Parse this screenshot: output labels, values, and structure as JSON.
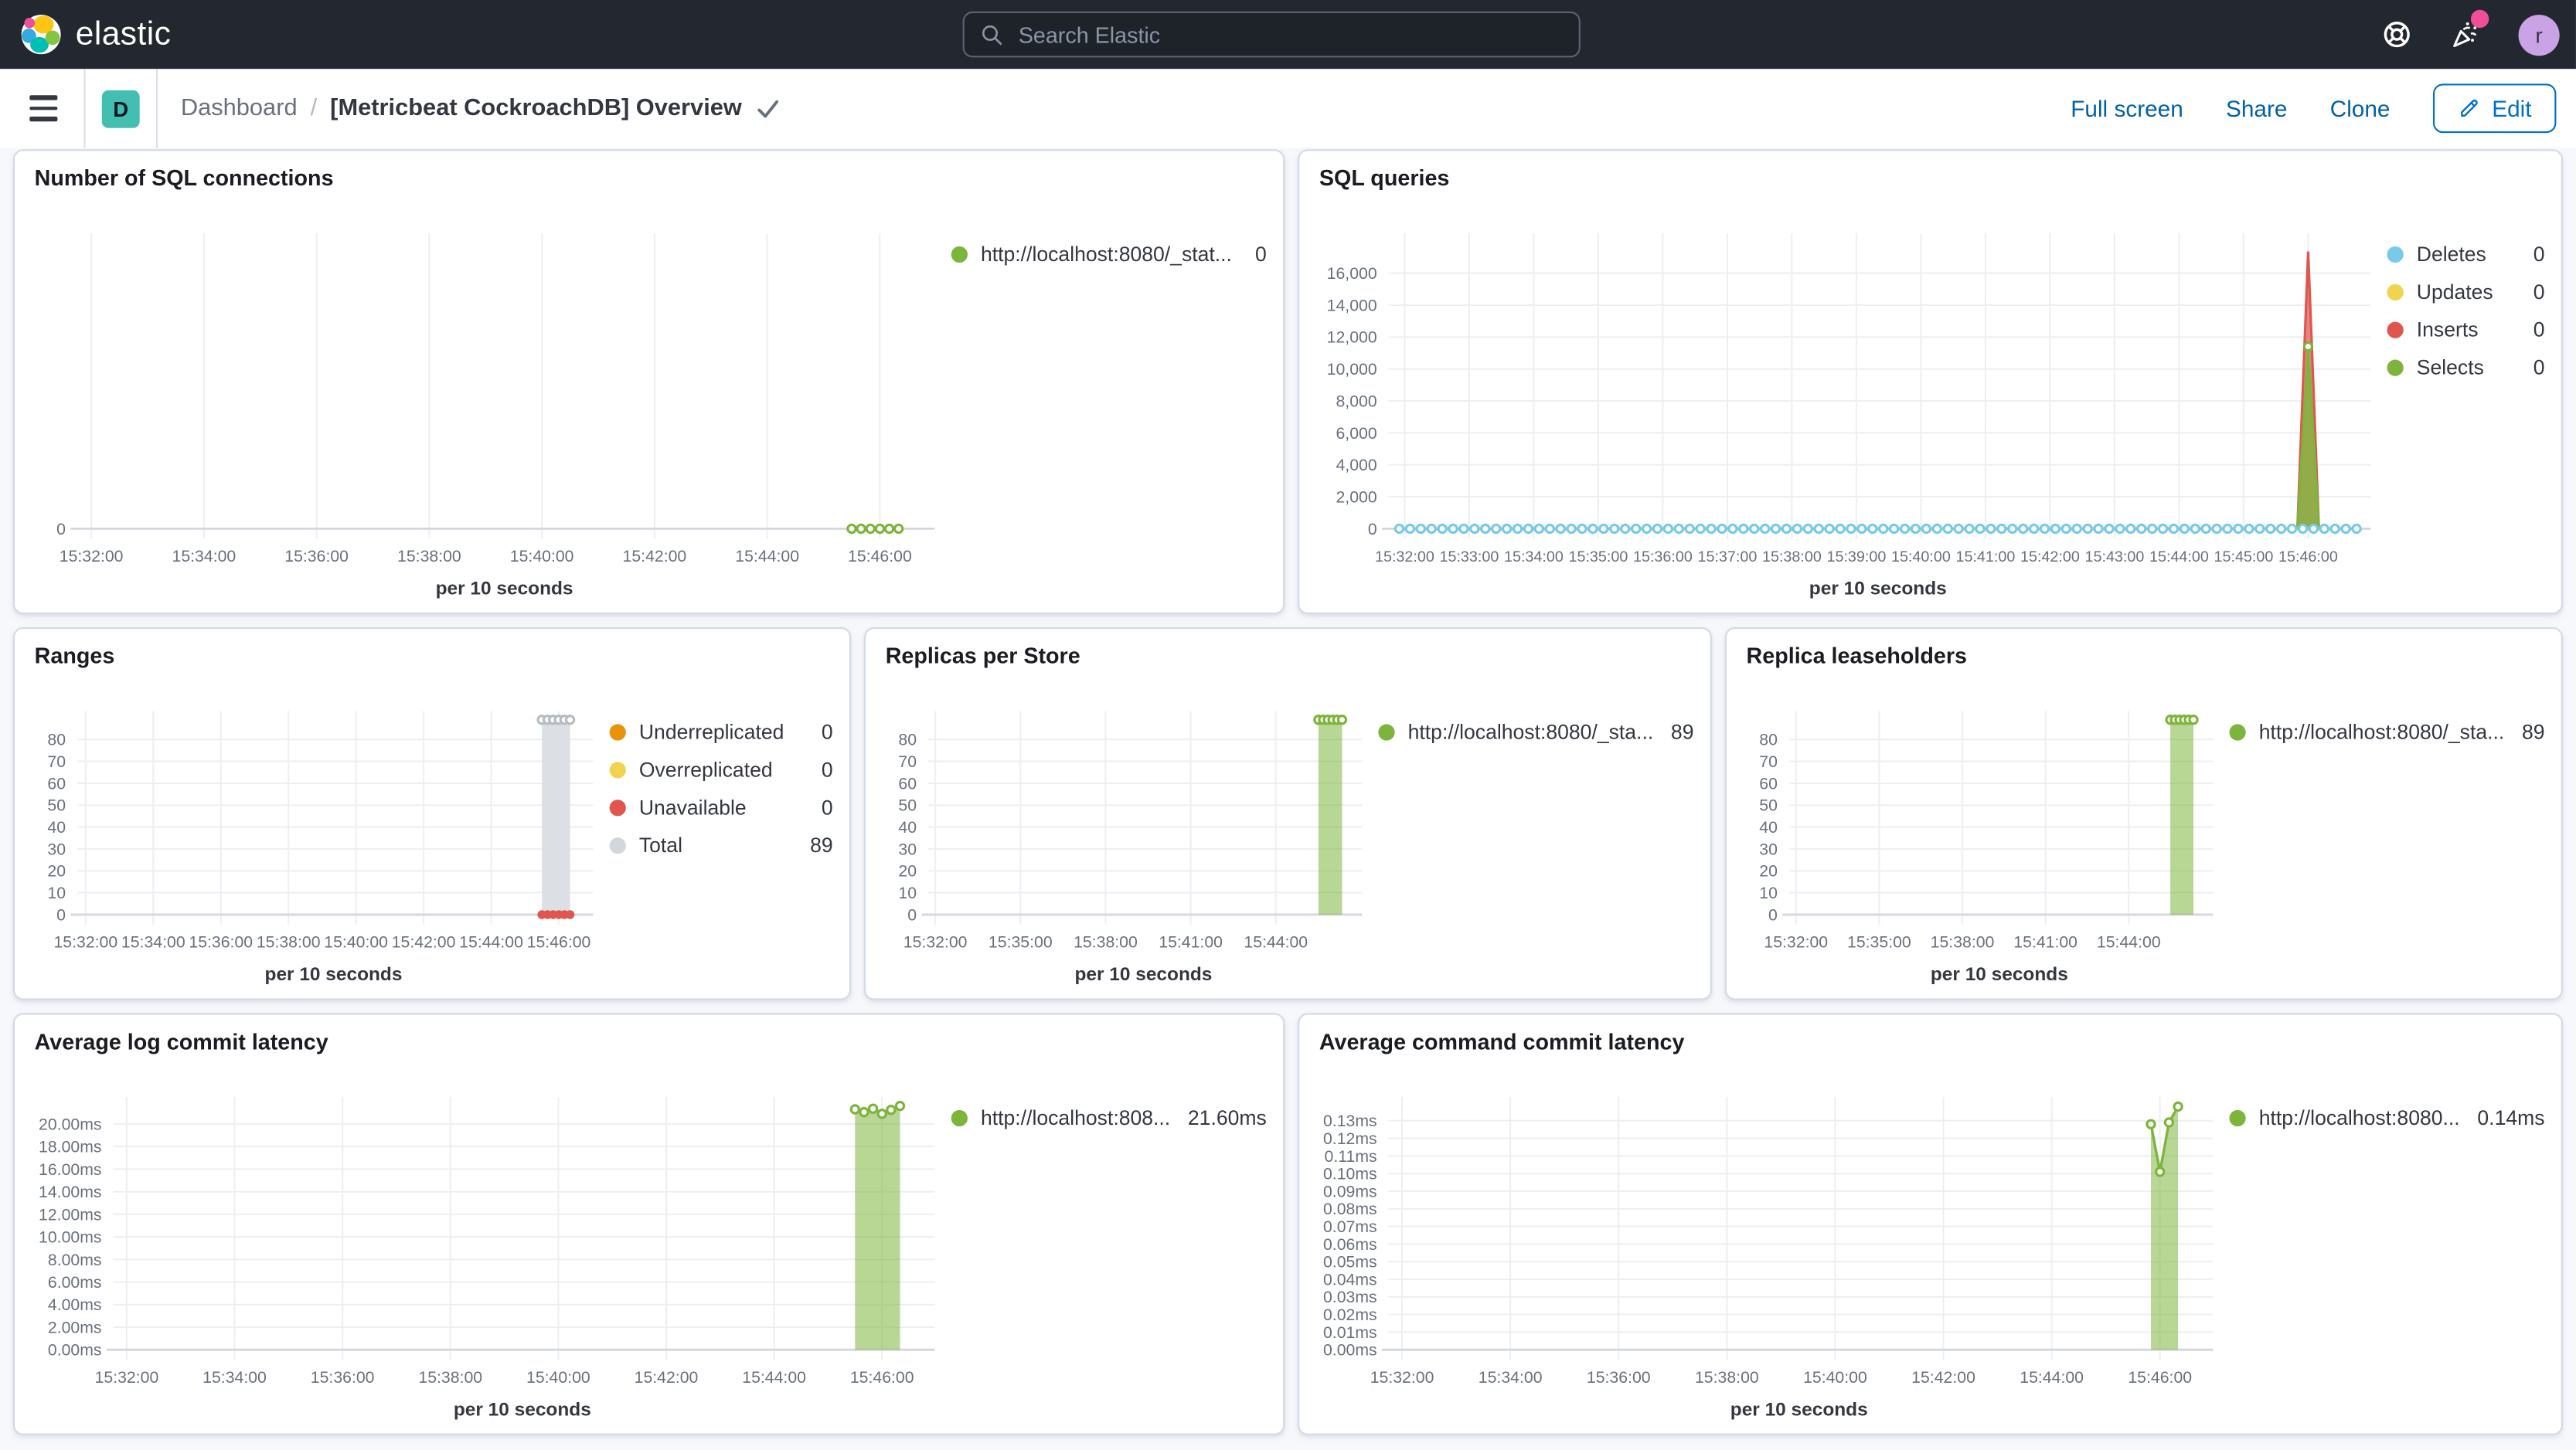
{
  "header": {
    "brand": "elastic",
    "search": {
      "placeholder": "Search Elastic"
    },
    "help_icon": "life-ring",
    "news_icon": "party-popper",
    "news_badge_color": "#f04e98",
    "avatar_initial": "r"
  },
  "toolbar": {
    "space_badge": "D",
    "breadcrumbs": [
      {
        "label": "Dashboard"
      }
    ],
    "separator": "/",
    "title": "[Metricbeat CockroachDB] Overview",
    "actions": [
      {
        "label": "Full screen"
      },
      {
        "label": "Share"
      },
      {
        "label": "Clone"
      }
    ],
    "edit_button": {
      "label": "Edit",
      "icon": "pencil"
    }
  },
  "colors": {
    "green": "#7db53c",
    "blue": "#79c9e8",
    "yellow": "#f0d44f",
    "red": "#e0564e",
    "orange": "#e8930c",
    "gray": "#d3d6db",
    "link_blue": "#0061a6",
    "header_bg": "#232830"
  },
  "panels": [
    {
      "title": "Number of SQL connections",
      "legend": [
        {
          "label": "http://localhost:8080/_stat...",
          "value": "0",
          "color": "#7db53c"
        }
      ],
      "chart_data": {
        "type": "line",
        "x_axis_title": "per 10 seconds",
        "x_domain": [
          0,
          910
        ],
        "y_max": 1,
        "x_ticks": [
          {
            "label": "15:32:00",
            "s": 15
          },
          {
            "label": "15:34:00",
            "s": 135
          },
          {
            "label": "15:36:00",
            "s": 255
          },
          {
            "label": "15:38:00",
            "s": 375
          },
          {
            "label": "15:40:00",
            "s": 495
          },
          {
            "label": "15:42:00",
            "s": 615
          },
          {
            "label": "15:44:00",
            "s": 735
          },
          {
            "label": "15:46:00",
            "s": 855
          }
        ],
        "y_ticks": [
          {
            "label": "0",
            "v": 0
          }
        ],
        "series": [
          {
            "name": "http://localhost:8080/_stat...",
            "color": "#7db53c",
            "width": 1.8,
            "expand": {
              "from": 825,
              "to": 875,
              "step": 10,
              "value": 0
            },
            "markers": {
              "shape": "hollow"
            }
          }
        ]
      }
    },
    {
      "title": "SQL queries",
      "legend": [
        {
          "label": "Deletes",
          "value": "0",
          "color": "#79c9e8"
        },
        {
          "label": "Updates",
          "value": "0",
          "color": "#f0d44f"
        },
        {
          "label": "Inserts",
          "value": "0",
          "color": "#e0564e"
        },
        {
          "label": "Selects",
          "value": "0",
          "color": "#7db53c"
        }
      ],
      "chart_data": {
        "type": "area",
        "x_axis_title": "per 10 seconds",
        "x_domain": [
          0,
          910
        ],
        "y_max": 18500,
        "x_ticks": [
          {
            "label": "15:32:00",
            "s": 15
          },
          {
            "label": "15:33:00",
            "s": 75
          },
          {
            "label": "15:34:00",
            "s": 135
          },
          {
            "label": "15:35:00",
            "s": 195
          },
          {
            "label": "15:36:00",
            "s": 255
          },
          {
            "label": "15:37:00",
            "s": 315
          },
          {
            "label": "15:38:00",
            "s": 375
          },
          {
            "label": "15:39:00",
            "s": 435
          },
          {
            "label": "15:40:00",
            "s": 495
          },
          {
            "label": "15:41:00",
            "s": 555
          },
          {
            "label": "15:42:00",
            "s": 615
          },
          {
            "label": "15:43:00",
            "s": 675
          },
          {
            "label": "15:44:00",
            "s": 735
          },
          {
            "label": "15:45:00",
            "s": 795
          },
          {
            "label": "15:46:00",
            "s": 855
          }
        ],
        "y_ticks": [
          {
            "label": "0",
            "v": 0
          },
          {
            "label": "2,000",
            "v": 2000
          },
          {
            "label": "4,000",
            "v": 4000
          },
          {
            "label": "6,000",
            "v": 6000
          },
          {
            "label": "8,000",
            "v": 8000
          },
          {
            "label": "10,000",
            "v": 10000
          },
          {
            "label": "12,000",
            "v": 12000
          },
          {
            "label": "14,000",
            "v": 14000
          },
          {
            "label": "16,000",
            "v": 16000
          }
        ],
        "series": [
          {
            "name": "Updates",
            "color": "#f0d44f",
            "hidden": true,
            "value": 0
          },
          {
            "name": "Inserts",
            "color": "#e0564e",
            "width": 1.5,
            "fill": "rgba(224,86,78,0.7)",
            "points": [
              [
                845,
                0
              ],
              [
                855,
                17350
              ],
              [
                865,
                0
              ]
            ]
          },
          {
            "name": "Selects",
            "color": "#7db53c",
            "width": 1.5,
            "fill": "rgba(125,181,60,0.8)",
            "points": [
              [
                845,
                0
              ],
              [
                855,
                11400
              ],
              [
                865,
                0
              ]
            ],
            "markers": {
              "shape": "hollow",
              "at": [
                855
              ]
            }
          },
          {
            "name": "Deletes",
            "color": "#79c9e8",
            "width": 1.8,
            "expand": {
              "from": 10,
              "to": 905,
              "step": 10,
              "value": 0,
              "overrides": [
                [
                  855,
                  17800
                ]
              ]
            },
            "markers": {
              "shape": "hollow"
            }
          }
        ]
      }
    },
    {
      "title": "Ranges",
      "legend": [
        {
          "label": "Underreplicated",
          "value": "0",
          "color": "#e8930c"
        },
        {
          "label": "Overreplicated",
          "value": "0",
          "color": "#f0d44f"
        },
        {
          "label": "Unavailable",
          "value": "0",
          "color": "#e0564e"
        },
        {
          "label": "Total",
          "value": "89",
          "color": "#d3d6db"
        }
      ],
      "chart_data": {
        "type": "area",
        "x_axis_title": "per 10 seconds",
        "x_domain": [
          0,
          910
        ],
        "y_max": 93,
        "x_ticks": [
          {
            "label": "15:32:00",
            "s": 15
          },
          {
            "label": "15:34:00",
            "s": 135
          },
          {
            "label": "15:36:00",
            "s": 255
          },
          {
            "label": "15:38:00",
            "s": 375
          },
          {
            "label": "15:40:00",
            "s": 495
          },
          {
            "label": "15:42:00",
            "s": 615
          },
          {
            "label": "15:44:00",
            "s": 735
          },
          {
            "label": "15:46:00",
            "s": 855
          }
        ],
        "y_ticks": [
          {
            "label": "0",
            "v": 0
          },
          {
            "label": "10",
            "v": 10
          },
          {
            "label": "20",
            "v": 20
          },
          {
            "label": "30",
            "v": 30
          },
          {
            "label": "40",
            "v": 40
          },
          {
            "label": "50",
            "v": 50
          },
          {
            "label": "60",
            "v": 60
          },
          {
            "label": "70",
            "v": 70
          },
          {
            "label": "80",
            "v": 80
          }
        ],
        "series": [
          {
            "name": "Underreplicated",
            "color": "#e8930c",
            "hidden": true,
            "value": 0
          },
          {
            "name": "Overreplicated",
            "color": "#f0d44f",
            "hidden": true,
            "value": 0
          },
          {
            "name": "Total",
            "color": "#ccd0d6",
            "width": 1.4,
            "fill": "#dcdfe3",
            "expand": {
              "from": 825,
              "to": 875,
              "step": 10,
              "value": 89
            },
            "markers": {
              "shape": "hollow",
              "stroke": "#b7bcc4"
            }
          },
          {
            "name": "Unavailable",
            "color": "#e0564e",
            "width": 2,
            "expand": {
              "from": 825,
              "to": 875,
              "step": 10,
              "value": 0
            },
            "markers": {
              "shape": "filled"
            }
          }
        ]
      }
    },
    {
      "title": "Replicas per Store",
      "legend": [
        {
          "label": "http://localhost:8080/_sta...",
          "value": "89",
          "color": "#7db53c"
        }
      ],
      "chart_data": {
        "type": "area",
        "x_axis_title": "per 10 seconds",
        "x_domain": [
          0,
          910
        ],
        "y_max": 93,
        "x_ticks": [
          {
            "label": "15:32:00",
            "s": 15
          },
          {
            "label": "15:35:00",
            "s": 195
          },
          {
            "label": "15:38:00",
            "s": 375
          },
          {
            "label": "15:41:00",
            "s": 555
          },
          {
            "label": "15:44:00",
            "s": 735
          }
        ],
        "y_ticks": [
          {
            "label": "0",
            "v": 0
          },
          {
            "label": "10",
            "v": 10
          },
          {
            "label": "20",
            "v": 20
          },
          {
            "label": "30",
            "v": 30
          },
          {
            "label": "40",
            "v": 40
          },
          {
            "label": "50",
            "v": 50
          },
          {
            "label": "60",
            "v": 60
          },
          {
            "label": "70",
            "v": 70
          },
          {
            "label": "80",
            "v": 80
          }
        ],
        "series": [
          {
            "name": "http://localhost:8080/_sta...",
            "color": "#7db53c",
            "width": 1.6,
            "fill": "rgba(125,181,60,0.55)",
            "expand": {
              "from": 825,
              "to": 875,
              "step": 10,
              "value": 89
            },
            "markers": {
              "shape": "hollow"
            }
          }
        ]
      }
    },
    {
      "title": "Replica leaseholders",
      "legend": [
        {
          "label": "http://localhost:8080/_sta...",
          "value": "89",
          "color": "#7db53c"
        }
      ],
      "chart_data": {
        "type": "area",
        "x_axis_title": "per 10 seconds",
        "x_domain": [
          0,
          910
        ],
        "y_max": 93,
        "x_ticks": [
          {
            "label": "15:32:00",
            "s": 15
          },
          {
            "label": "15:35:00",
            "s": 195
          },
          {
            "label": "15:38:00",
            "s": 375
          },
          {
            "label": "15:41:00",
            "s": 555
          },
          {
            "label": "15:44:00",
            "s": 735
          }
        ],
        "y_ticks": [
          {
            "label": "0",
            "v": 0
          },
          {
            "label": "10",
            "v": 10
          },
          {
            "label": "20",
            "v": 20
          },
          {
            "label": "30",
            "v": 30
          },
          {
            "label": "40",
            "v": 40
          },
          {
            "label": "50",
            "v": 50
          },
          {
            "label": "60",
            "v": 60
          },
          {
            "label": "70",
            "v": 70
          },
          {
            "label": "80",
            "v": 80
          }
        ],
        "series": [
          {
            "name": "http://localhost:8080/_sta...",
            "color": "#7db53c",
            "width": 1.6,
            "fill": "rgba(125,181,60,0.55)",
            "expand": {
              "from": 825,
              "to": 875,
              "step": 10,
              "value": 89
            },
            "markers": {
              "shape": "hollow"
            }
          }
        ]
      }
    },
    {
      "title": "Average log commit latency",
      "legend": [
        {
          "label": "http://localhost:808...",
          "value": "21.60ms",
          "color": "#7db53c"
        }
      ],
      "chart_data": {
        "type": "area",
        "x_axis_title": "per 10 seconds",
        "x_domain": [
          0,
          910
        ],
        "y_max": 22.4,
        "x_ticks": [
          {
            "label": "15:32:00",
            "s": 15
          },
          {
            "label": "15:34:00",
            "s": 135
          },
          {
            "label": "15:36:00",
            "s": 255
          },
          {
            "label": "15:38:00",
            "s": 375
          },
          {
            "label": "15:40:00",
            "s": 495
          },
          {
            "label": "15:42:00",
            "s": 615
          },
          {
            "label": "15:44:00",
            "s": 735
          },
          {
            "label": "15:46:00",
            "s": 855
          }
        ],
        "y_ticks": [
          {
            "label": "0.00ms",
            "v": 0
          },
          {
            "label": "2.00ms",
            "v": 2
          },
          {
            "label": "4.00ms",
            "v": 4
          },
          {
            "label": "6.00ms",
            "v": 6
          },
          {
            "label": "8.00ms",
            "v": 8
          },
          {
            "label": "10.00ms",
            "v": 10
          },
          {
            "label": "12.00ms",
            "v": 12
          },
          {
            "label": "14.00ms",
            "v": 14
          },
          {
            "label": "16.00ms",
            "v": 16
          },
          {
            "label": "18.00ms",
            "v": 18
          },
          {
            "label": "20.00ms",
            "v": 20
          }
        ],
        "series": [
          {
            "name": "http://localhost:808...",
            "color": "#7db53c",
            "width": 1.6,
            "fill": "rgba(125,181,60,0.55)",
            "points": [
              [
                825,
                21.3
              ],
              [
                835,
                21.05
              ],
              [
                845,
                21.35
              ],
              [
                855,
                20.9
              ],
              [
                865,
                21.25
              ],
              [
                875,
                21.6
              ]
            ],
            "markers": {
              "shape": "hollow"
            }
          }
        ]
      }
    },
    {
      "title": "Average command commit latency",
      "legend": [
        {
          "label": "http://localhost:8080...",
          "value": "0.14ms",
          "color": "#7db53c"
        }
      ],
      "chart_data": {
        "type": "area",
        "x_axis_title": "per 10 seconds",
        "x_domain": [
          0,
          910
        ],
        "y_max": 0.1435,
        "x_ticks": [
          {
            "label": "15:32:00",
            "s": 15
          },
          {
            "label": "15:34:00",
            "s": 135
          },
          {
            "label": "15:36:00",
            "s": 255
          },
          {
            "label": "15:38:00",
            "s": 375
          },
          {
            "label": "15:40:00",
            "s": 495
          },
          {
            "label": "15:42:00",
            "s": 615
          },
          {
            "label": "15:44:00",
            "s": 735
          },
          {
            "label": "15:46:00",
            "s": 855
          }
        ],
        "y_ticks": [
          {
            "label": "0.00ms",
            "v": 0
          },
          {
            "label": "0.01ms",
            "v": 0.01
          },
          {
            "label": "0.02ms",
            "v": 0.02
          },
          {
            "label": "0.03ms",
            "v": 0.03
          },
          {
            "label": "0.04ms",
            "v": 0.04
          },
          {
            "label": "0.05ms",
            "v": 0.05
          },
          {
            "label": "0.06ms",
            "v": 0.06
          },
          {
            "label": "0.07ms",
            "v": 0.07
          },
          {
            "label": "0.08ms",
            "v": 0.08
          },
          {
            "label": "0.09ms",
            "v": 0.09
          },
          {
            "label": "0.10ms",
            "v": 0.1
          },
          {
            "label": "0.11ms",
            "v": 0.11
          },
          {
            "label": "0.12ms",
            "v": 0.12
          },
          {
            "label": "0.13ms",
            "v": 0.13
          }
        ],
        "series": [
          {
            "name": "http://localhost:8080...",
            "color": "#7db53c",
            "width": 1.6,
            "fill": "rgba(125,181,60,0.55)",
            "points": [
              [
                845,
                0.128
              ],
              [
                855,
                0.101
              ],
              [
                865,
                0.129
              ],
              [
                875,
                0.138
              ]
            ],
            "markers": {
              "shape": "hollow"
            }
          }
        ]
      }
    }
  ]
}
